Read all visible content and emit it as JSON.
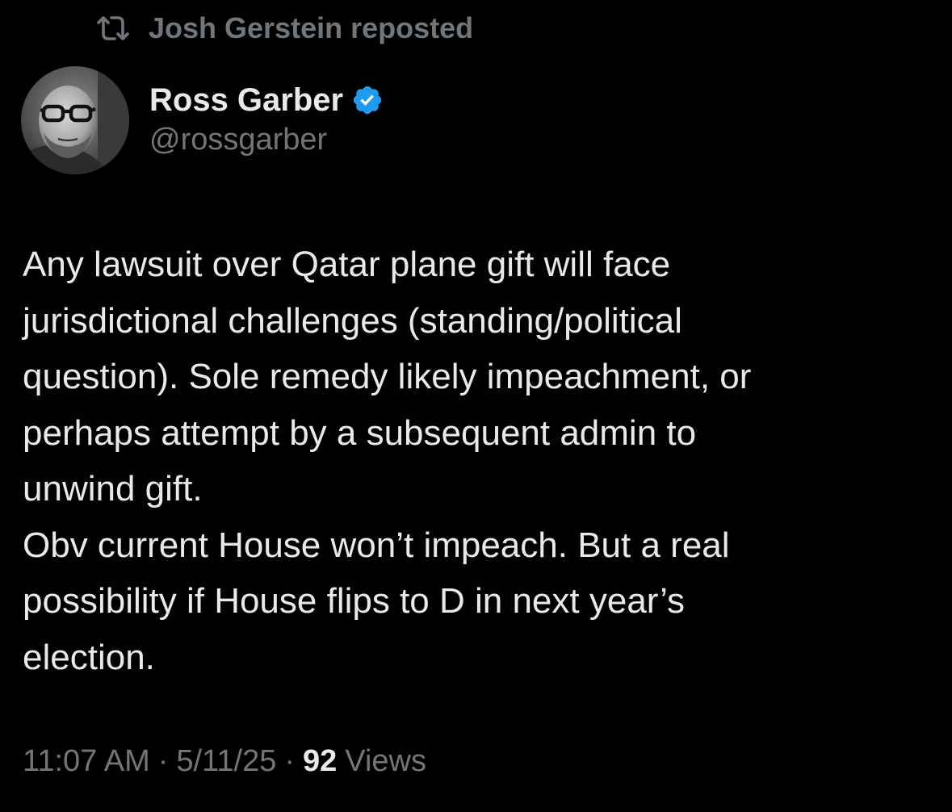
{
  "repost": {
    "icon": "repost-icon",
    "text": "Josh Gerstein reposted"
  },
  "author": {
    "display_name": "Ross Garber",
    "handle": "@rossgarber",
    "verified_icon": "verified-badge-icon",
    "verified_color": "#1d9bf0",
    "avatar": "avatar"
  },
  "tweet": {
    "text": "Any lawsuit over Qatar plane gift will face\njurisdictional challenges (standing/political\nquestion). Sole remedy likely impeachment, or\nperhaps attempt by a subsequent admin to\nunwind gift.\nObv current House won’t impeach. But a real\npossibility if House flips to D in next year’s\nelection."
  },
  "meta": {
    "time": "11:07 AM",
    "separator": "·",
    "date": "5/11/25",
    "views_count": "92",
    "views_label": "Views"
  },
  "colors": {
    "background": "#000000",
    "text_primary": "#e7e9ea",
    "text_secondary": "#71767b",
    "accent": "#1d9bf0"
  }
}
